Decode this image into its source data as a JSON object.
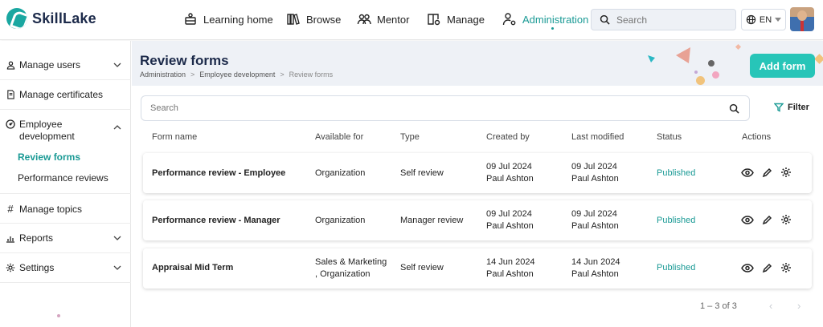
{
  "app": {
    "name": "SkillLake"
  },
  "nav": {
    "items": [
      {
        "label": "Learning home",
        "icon": "learning-home-icon"
      },
      {
        "label": "Browse",
        "icon": "browse-icon"
      },
      {
        "label": "Mentor",
        "icon": "mentor-icon"
      },
      {
        "label": "Manage",
        "icon": "manage-icon"
      },
      {
        "label": "Administration",
        "icon": "administration-icon",
        "active": true
      }
    ],
    "search_placeholder": "Search",
    "language": "EN"
  },
  "sidebar": {
    "items": [
      {
        "label": "Manage users",
        "icon": "user-icon"
      },
      {
        "label": "Manage certificates",
        "icon": "certificate-icon"
      },
      {
        "label": "Employee development",
        "icon": "gauge-icon"
      },
      {
        "label": "Manage topics",
        "icon": "hashtag-icon"
      },
      {
        "label": "Reports",
        "icon": "chart-icon"
      },
      {
        "label": "Settings",
        "icon": "gear-icon"
      }
    ],
    "employee_development_line1": "Employee",
    "employee_development_line2": "development",
    "subitems": [
      {
        "label": "Review forms",
        "active": true
      },
      {
        "label": "Performance reviews"
      }
    ]
  },
  "page": {
    "title": "Review forms",
    "breadcrumb": [
      "Administration",
      "Employee development",
      "Review forms"
    ],
    "add_button": "Add form",
    "search_placeholder": "Search",
    "filter_label": "Filter"
  },
  "table": {
    "headers": [
      "Form name",
      "Available for",
      "Type",
      "Created by",
      "Last modified",
      "Status",
      "Actions"
    ],
    "rows": [
      {
        "name": "Performance review - Employee",
        "available_1": "Organization",
        "available_2": "",
        "type": "Self review",
        "created_date": "09 Jul 2024",
        "created_by": "Paul Ashton",
        "modified_date": "09 Jul 2024",
        "modified_by": "Paul Ashton",
        "status": "Published"
      },
      {
        "name": "Performance review - Manager",
        "available_1": "Organization",
        "available_2": "",
        "type": "Manager review",
        "created_date": "09 Jul 2024",
        "created_by": "Paul Ashton",
        "modified_date": "09 Jul 2024",
        "modified_by": "Paul Ashton",
        "status": "Published"
      },
      {
        "name": "Appraisal Mid Term",
        "available_1": "Sales & Marketing",
        "available_2": ", Organization",
        "type": "Self review",
        "created_date": "14 Jun 2024",
        "created_by": "Paul Ashton",
        "modified_date": "14 Jun 2024",
        "modified_by": "Paul Ashton",
        "status": "Published"
      }
    ]
  },
  "pagination": {
    "range": "1 – 3 of 3",
    "prev": "‹",
    "next": "›"
  },
  "colors": {
    "accent": "#1a9a95",
    "button": "#27c5b8",
    "banner_bg": "#eef1f6"
  }
}
